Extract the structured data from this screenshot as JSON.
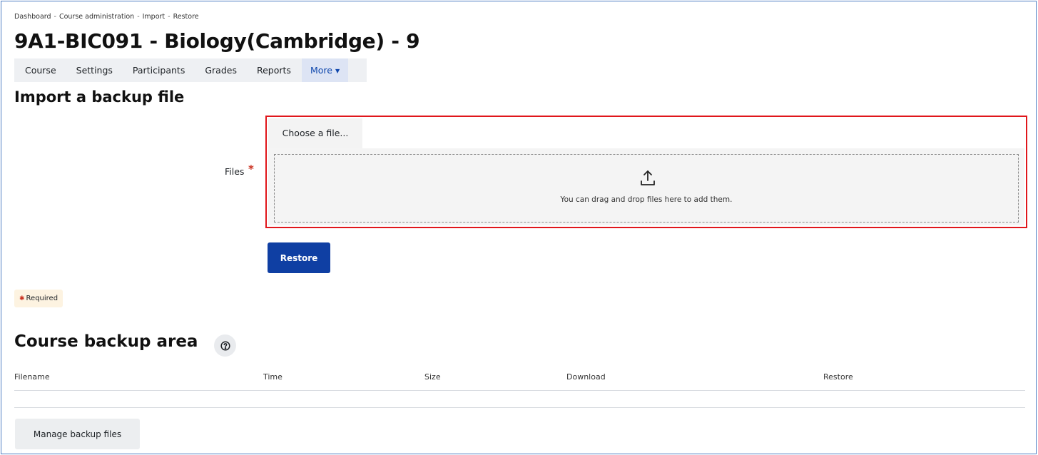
{
  "breadcrumb": [
    "Dashboard",
    "Course administration",
    "Import",
    "Restore"
  ],
  "breadcrumb_sep": "-",
  "page_title": "9A1-BIC091 - Biology(Cambridge) - 9",
  "secondary_nav": {
    "tabs": [
      "Course",
      "Settings",
      "Participants",
      "Grades",
      "Reports"
    ],
    "more_label": "More"
  },
  "import_section": {
    "heading": "Import a backup file",
    "files_label": "Files",
    "required_marker": "*",
    "choose_file_label": "Choose a file...",
    "drop_text": "You can drag and drop files here to add them.",
    "restore_button": "Restore"
  },
  "required_note": "Required",
  "backup_area": {
    "heading": "Course backup area",
    "columns": [
      "Filename",
      "Time",
      "Size",
      "Download",
      "Restore"
    ],
    "manage_button": "Manage backup files"
  },
  "icons": {
    "upload": "upload-icon",
    "help": "help-circle-icon",
    "caret": "chevron-down-icon"
  },
  "colors": {
    "primary": "#0f3fa3",
    "highlight_border": "#e0161b",
    "required": "#ca3120",
    "nav_bg": "#eef0f3"
  }
}
